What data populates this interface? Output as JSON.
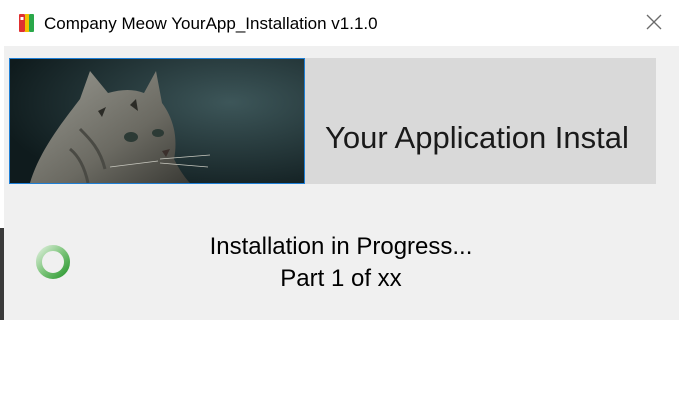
{
  "window": {
    "title": "Company Meow YourApp_Installation v1.1.0",
    "app_icon": "installer-book-icon",
    "close_icon": "close-icon"
  },
  "banner": {
    "image": "cat-photo",
    "text": "Your Application Instal"
  },
  "progress": {
    "spinner_icon": "busy-spinner-icon",
    "status_line1": "Installation in Progress...",
    "status_line2": "Part 1 of xx"
  },
  "colors": {
    "spinner_green": "#3aa63a",
    "banner_bg": "#d9d9d9",
    "image_border": "#1e7fd6",
    "window_bg": "#f0f0f0"
  }
}
